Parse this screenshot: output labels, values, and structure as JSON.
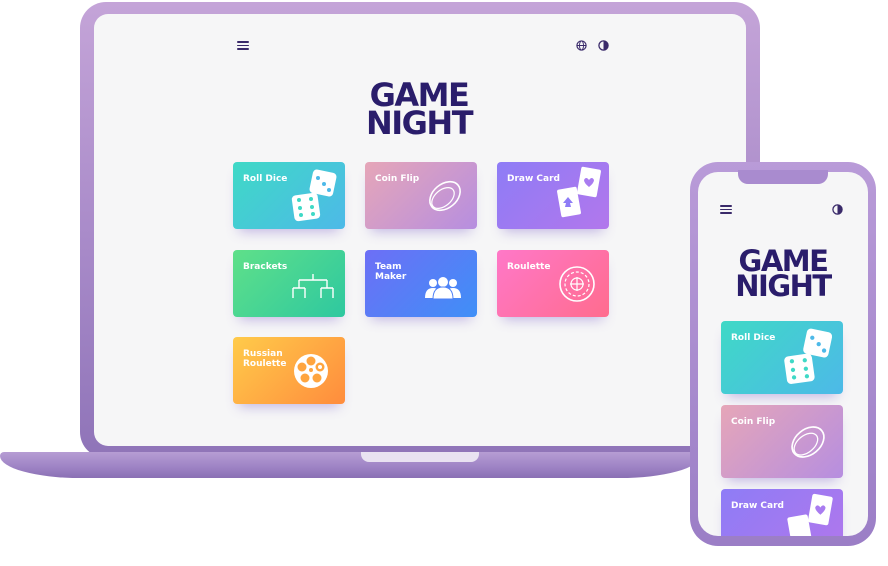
{
  "laptop": {
    "header": {
      "menu_icon": "hamburger-menu-icon",
      "language_icon": "globe-icon",
      "theme_icon": "contrast-icon"
    },
    "logo": {
      "line1": "GAME",
      "line2": "NIGHT"
    },
    "cards": [
      {
        "label": "Roll Dice",
        "icon": "dice-icon"
      },
      {
        "label": "Coin Flip",
        "icon": "coin-icon"
      },
      {
        "label": "Draw Card",
        "icon": "playing-cards-icon"
      },
      {
        "label": "Brackets",
        "icon": "bracket-icon"
      },
      {
        "label": "Team Maker",
        "icon": "team-icon"
      },
      {
        "label": "Roulette",
        "icon": "roulette-wheel-icon"
      },
      {
        "label": "Russian Roulette",
        "icon": "revolver-cylinder-icon"
      }
    ]
  },
  "phone": {
    "header": {
      "menu_icon": "hamburger-menu-icon",
      "theme_icon": "contrast-icon"
    },
    "logo": {
      "line1": "GAME",
      "line2": "NIGHT"
    },
    "cards": [
      {
        "label": "Roll Dice",
        "icon": "dice-icon"
      },
      {
        "label": "Coin Flip",
        "icon": "coin-icon"
      },
      {
        "label": "Draw Card",
        "icon": "playing-cards-icon"
      }
    ]
  },
  "colors": {
    "brand": "#2a1d6b",
    "device_frame": "#a789c8",
    "screen_bg": "#f6f6f7"
  }
}
